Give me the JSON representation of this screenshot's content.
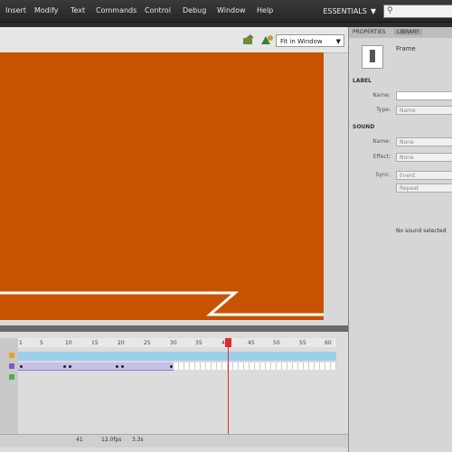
{
  "menu": [
    "Insert",
    "Modify",
    "Text",
    "Commands",
    "Control",
    "Debug",
    "Window",
    "Help"
  ],
  "workspace": {
    "label": "ESSENTIALS",
    "arrow": "▼"
  },
  "search": {
    "icon": "search-icon",
    "placeholder": ""
  },
  "stage": {
    "zoom": "Fit in Window",
    "zoom_arrow": "▼",
    "background": "#c95200",
    "edit_icons": [
      "edit-scene-icon",
      "edit-symbol-icon"
    ]
  },
  "panel": {
    "tab_properties": "PROPERTIES",
    "tab_library": "LIBRARY",
    "selection": "Frame",
    "label_section": "LABEL",
    "name_label": "Name:",
    "type_label": "Type:",
    "type_value": "Name",
    "sound_section": "SOUND",
    "sound_name_label": "Name:",
    "sound_name_value": "None",
    "effect_label": "Effect:",
    "effect_value": "None",
    "sync_label": "Sync:",
    "sync_value": "Event",
    "repeat_value": "Repeat",
    "no_sound": "No sound selected"
  },
  "timeline": {
    "ruler": [
      "1",
      "5",
      "10",
      "15",
      "20",
      "25",
      "30",
      "35",
      "40",
      "45",
      "50",
      "55",
      "60"
    ],
    "current_frame": "41",
    "fps": "12.0fps",
    "time": "3.3s"
  }
}
